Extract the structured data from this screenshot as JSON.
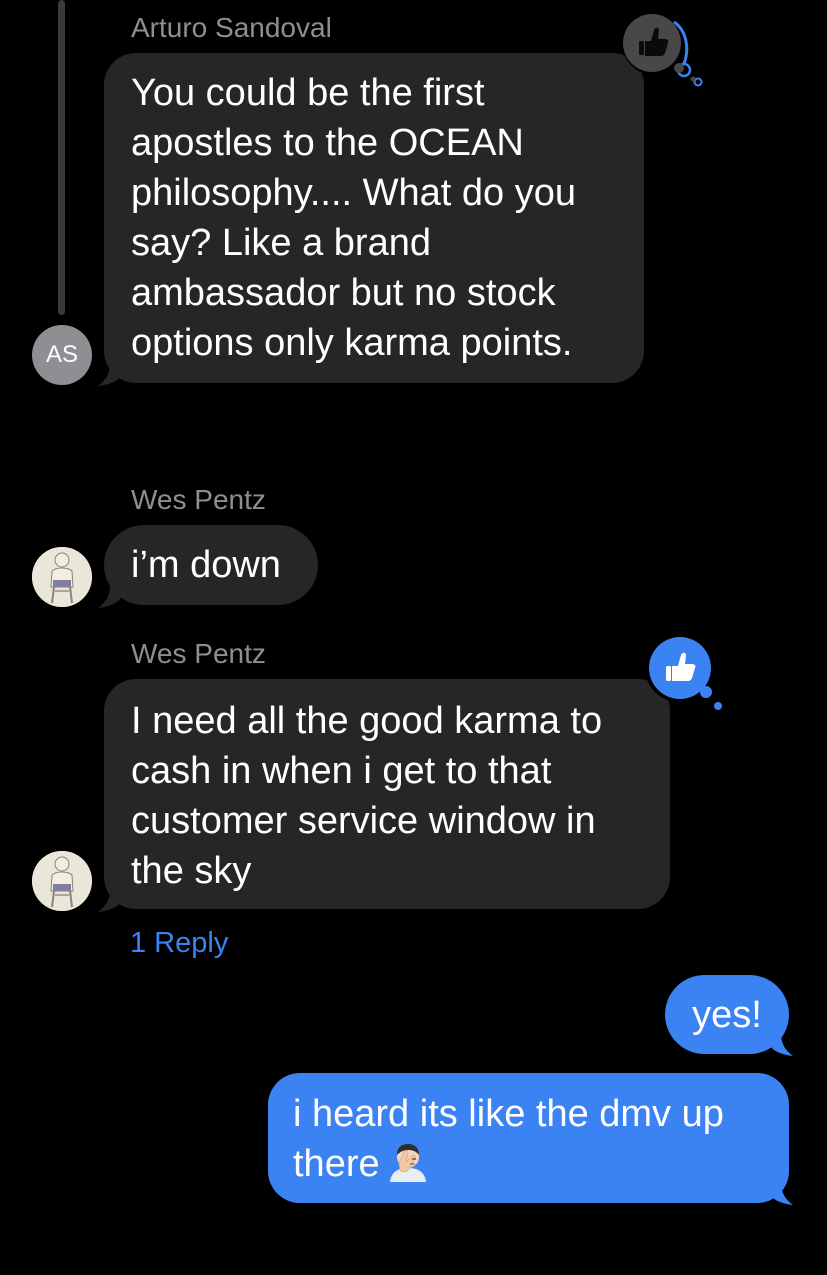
{
  "colors": {
    "background": "#000000",
    "incoming_bubble": "#262628",
    "outgoing_bubble": "#3b82f3",
    "sender_name": "#8e8e93",
    "link": "#3b82f3",
    "reaction_gray": "#48484a",
    "reaction_blue": "#3b82f3"
  },
  "messages": [
    {
      "sender": "Arturo Sandoval",
      "avatar_initials": "AS",
      "text": "You could be the first\napostles to the OCEAN\nphilosophy.... What do you\nsay? Like a brand\nambassador but no stock\noptions only karma points.",
      "reaction_icon": "thumbs-up-icon"
    },
    {
      "sender": "Wes Pentz",
      "avatar_icon": "sketch-figure-avatar",
      "text": "i’m down"
    },
    {
      "sender": "Wes Pentz",
      "avatar_icon": "sketch-figure-avatar",
      "text": "I need all the good karma to\ncash in when i get to that\ncustomer service window in\nthe sky",
      "reaction_icon": "thumbs-up-icon",
      "reply_link": "1 Reply"
    },
    {
      "text": "yes!"
    },
    {
      "text": "i heard its like the dmv up\nthere",
      "emoji_icon": "facepalm-emoji-icon"
    }
  ]
}
